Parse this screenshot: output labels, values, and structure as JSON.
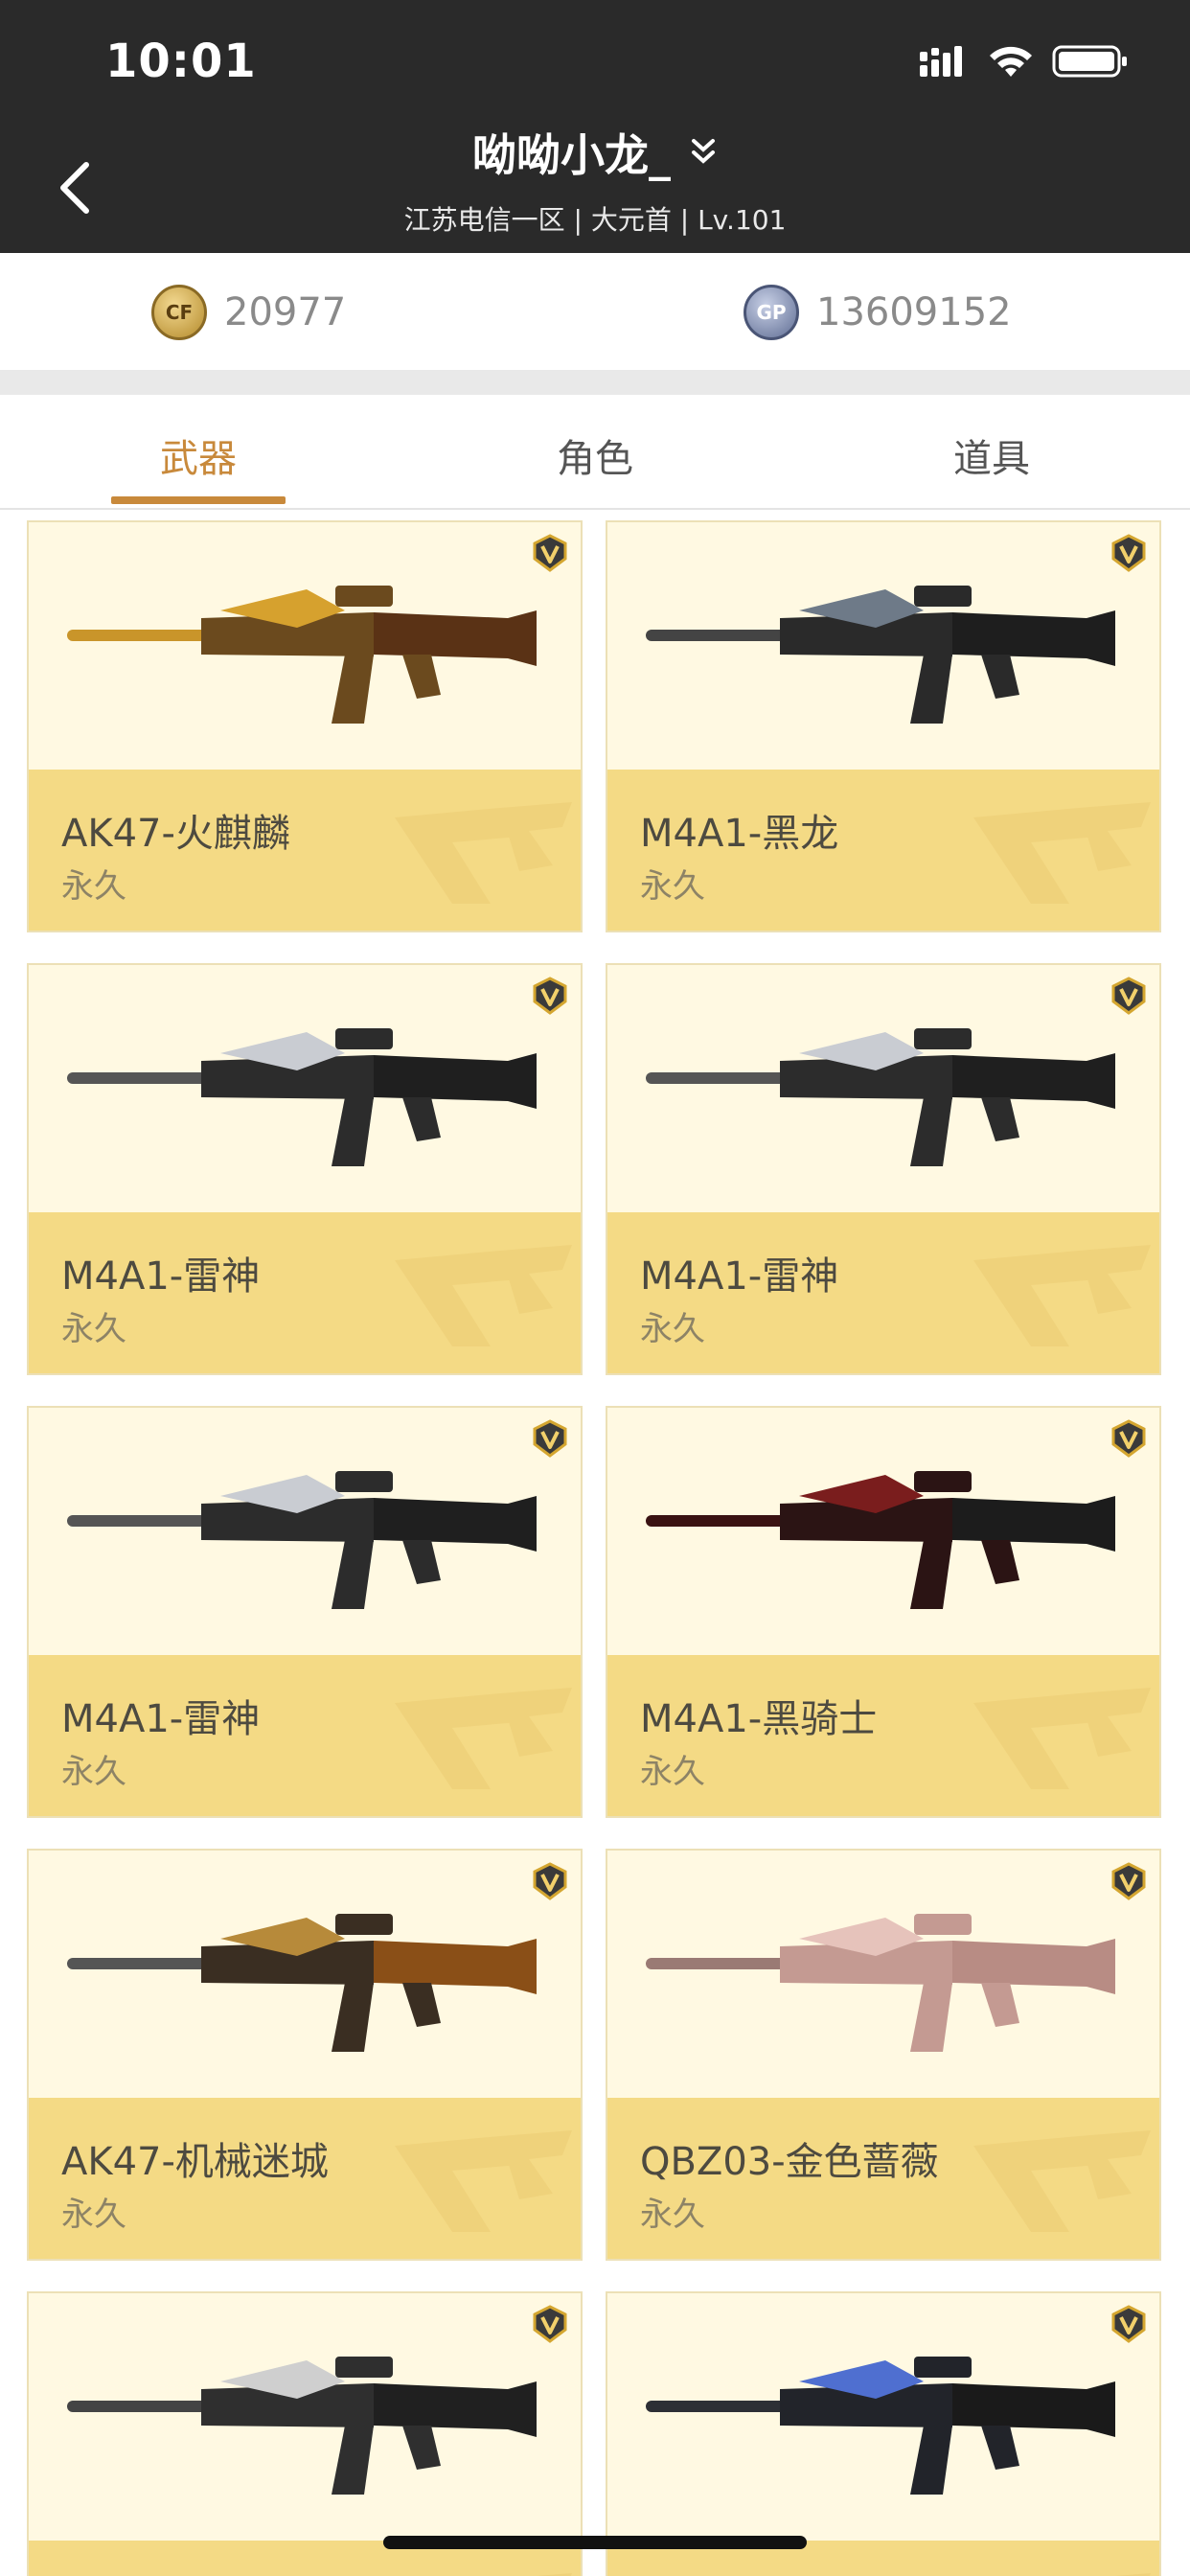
{
  "status_bar": {
    "time": "10:01"
  },
  "header": {
    "title": "呦呦小龙_",
    "subtitle": "江苏电信一区 | 大元首 | Lv.101"
  },
  "currency": {
    "cf_points": "20977",
    "gp_points": "13609152",
    "cf_icon_text": "CF",
    "gp_icon_text": "GP"
  },
  "tabs": [
    "武器",
    "角色",
    "道具"
  ],
  "active_tab": "武器",
  "items": [
    {
      "name": "AK47-火麒麟",
      "duration": "永久",
      "gun": "ak-gold"
    },
    {
      "name": "M4A1-黑龙",
      "duration": "永久",
      "gun": "m4-dragon"
    },
    {
      "name": "M4A1-雷神",
      "duration": "永久",
      "gun": "m4-thor"
    },
    {
      "name": "M4A1-雷神",
      "duration": "永久",
      "gun": "m4-thor"
    },
    {
      "name": "M4A1-雷神",
      "duration": "永久",
      "gun": "m4-thor"
    },
    {
      "name": "M4A1-黑骑士",
      "duration": "永久",
      "gun": "m4-knight"
    },
    {
      "name": "AK47-机械迷城",
      "duration": "永久",
      "gun": "ak-mech"
    },
    {
      "name": "QBZ03-金色蔷薇",
      "duration": "永久",
      "gun": "qbz-rose"
    },
    {
      "name": "",
      "duration": "",
      "gun": "ak-silver"
    },
    {
      "name": "",
      "duration": "",
      "gun": "ak-dark"
    }
  ],
  "colors": {
    "header_bg": "#2a2a2a",
    "accent": "#c8893b",
    "card_info_bg": "#f4da85",
    "card_image_bg": "#fff9e2"
  }
}
